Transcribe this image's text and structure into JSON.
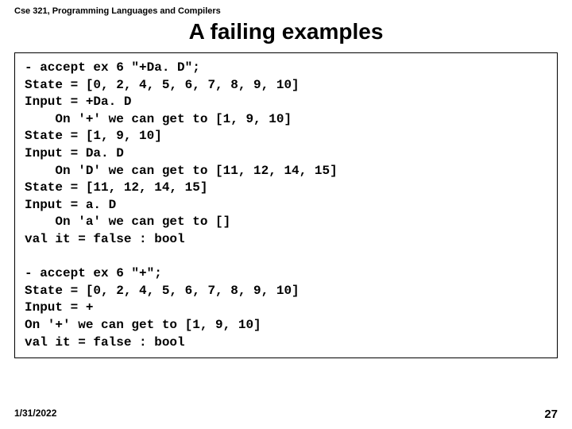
{
  "header": "Cse 321, Programming Languages and Compilers",
  "title": "A failing examples",
  "code": {
    "block1": {
      "l1": "- accept ex 6 \"+Da. D\";",
      "l2": "State = [0, 2, 4, 5, 6, 7, 8, 9, 10]",
      "l3": "Input = +Da. D",
      "l4": "    On '+' we can get to [1, 9, 10]",
      "l5": "State = [1, 9, 10]",
      "l6": "Input = Da. D",
      "l7": "    On 'D' we can get to [11, 12, 14, 15]",
      "l8": "State = [11, 12, 14, 15]",
      "l9": "Input = a. D",
      "l10": "    On 'a' we can get to []",
      "l11": "val it = false : bool"
    },
    "block2": {
      "l1": "- accept ex 6 \"+\";",
      "l2": "State = [0, 2, 4, 5, 6, 7, 8, 9, 10]",
      "l3": "Input = +",
      "l4": "On '+' we can get to [1, 9, 10]",
      "l5": "val it = false : bool"
    }
  },
  "footer": {
    "date": "1/31/2022",
    "page": "27"
  }
}
